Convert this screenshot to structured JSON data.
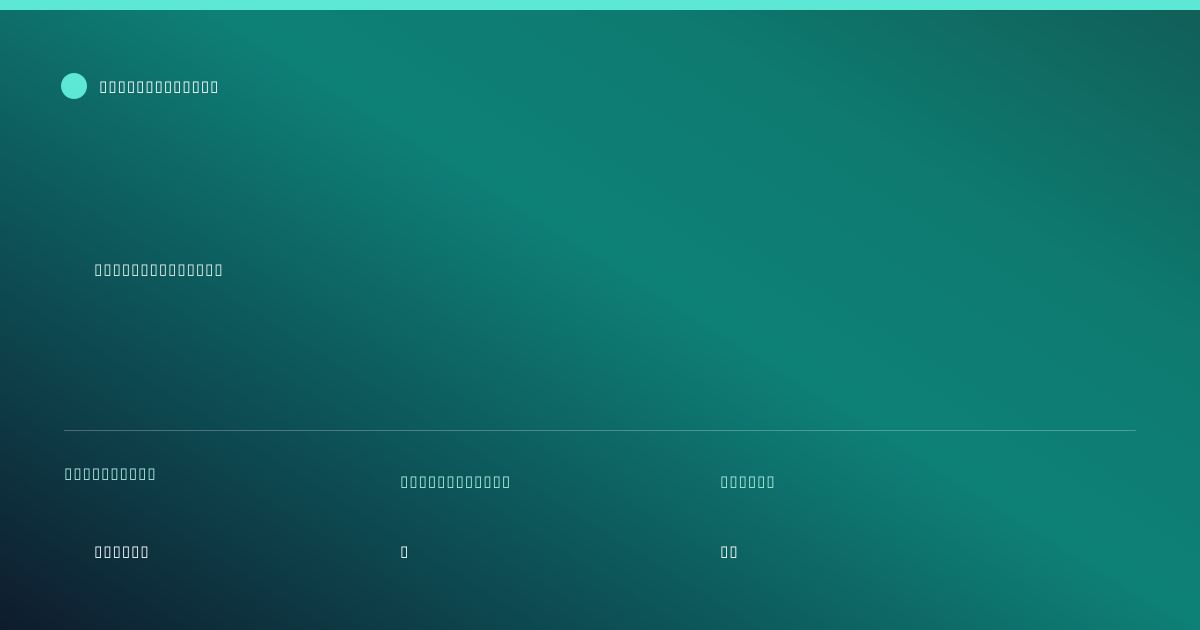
{
  "colors": {
    "accent": "#5ce8d4",
    "text": "#ffffff",
    "label": "#a9f0e4"
  },
  "brand": {
    "name": "▯▯▯▯▯▯▯▯▯▯▯▯▯"
  },
  "headline": "▯▯▯▯▯▯▯▯▯▯▯▯▯▯",
  "stats": [
    {
      "label": "▯▯▯▯▯▯▯▯▯▯",
      "value": "▯▯▯▯▯▯"
    },
    {
      "label": "▯▯▯▯▯▯▯▯▯▯▯▯",
      "value": "▯"
    },
    {
      "label": "▯▯▯▯▯▯",
      "value": "▯▯"
    }
  ]
}
